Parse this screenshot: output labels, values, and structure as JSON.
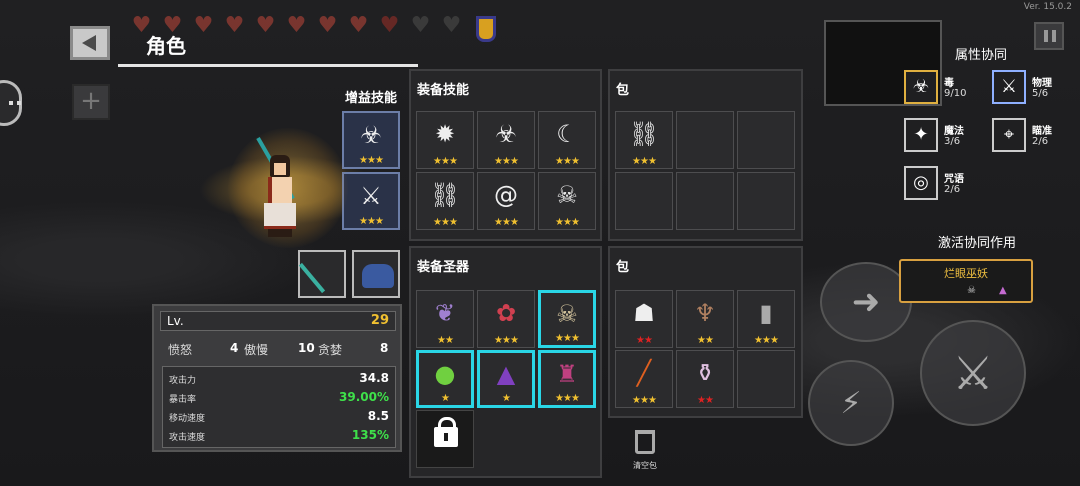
{
  "version": "Ver. 15.0.2",
  "title": "角色",
  "hearts": {
    "full": 8,
    "empty": 3,
    "half": 1
  },
  "bonus_skills": {
    "label": "增益技能",
    "slots": [
      {
        "icon": "biohazard-scythe-icon",
        "stars": "★★★"
      },
      {
        "icon": "crossed-weapons-icon",
        "stars": "★★★"
      }
    ]
  },
  "stats": {
    "lv_label": "Lv.",
    "lv_value": "29",
    "sins": [
      {
        "label": "愤怒",
        "value": "4"
      },
      {
        "label": "傲慢",
        "value": "10"
      },
      {
        "label": "贪婪",
        "value": "8"
      }
    ],
    "attributes": [
      {
        "label": "攻击力",
        "value": "34.8",
        "color": "#ffffff"
      },
      {
        "label": "暴击率",
        "value": "39.00%",
        "color": "#3ee04a"
      },
      {
        "label": "移动速度",
        "value": "8.5",
        "color": "#ffffff"
      },
      {
        "label": "攻击速度",
        "value": "135%",
        "color": "#3ee04a"
      }
    ]
  },
  "equip_skills": {
    "title": "装备技能",
    "slots": [
      {
        "icon": "spiked-wreath-icon",
        "stars": "★★★"
      },
      {
        "icon": "biohazard-icon",
        "stars": "★★★"
      },
      {
        "icon": "crescent-moon-icon",
        "stars": "★★★"
      },
      {
        "icon": "chain-link-icon",
        "stars": "★★★"
      },
      {
        "icon": "spiral-icon",
        "stars": "★★★"
      },
      {
        "icon": "skull-burst-icon",
        "stars": "★★★"
      }
    ]
  },
  "skill_bag": {
    "title": "包",
    "slots": [
      {
        "icon": "chain-link-icon",
        "stars": "★★★"
      }
    ]
  },
  "equip_relics": {
    "title": "装备圣器",
    "slots": [
      {
        "icon": "feather-icon",
        "stars": "★★"
      },
      {
        "icon": "red-flower-icon",
        "stars": "★★★"
      },
      {
        "icon": "skull-icon",
        "stars": "★★★"
      },
      {
        "icon": "green-slime-icon",
        "stars": "★"
      },
      {
        "icon": "purple-cloak-icon",
        "stars": "★"
      },
      {
        "icon": "potion-bottle-icon",
        "stars": "★★★"
      }
    ]
  },
  "relic_bag": {
    "title": "包",
    "slots": [
      {
        "icon": "white-mask-icon",
        "stars": "★★",
        "red": true
      },
      {
        "icon": "bone-figure-icon",
        "stars": "★★",
        "red": false
      },
      {
        "icon": "tombstone-icon",
        "stars": "★★★",
        "red": false
      },
      {
        "icon": "flame-sword-icon",
        "stars": "★★★",
        "red": false
      },
      {
        "icon": "flask-icon",
        "stars": "★★",
        "red": true
      }
    ]
  },
  "clear_bag": "清空包",
  "synergy": {
    "title": "属性协同",
    "items": [
      {
        "icon": "biohazard-icon",
        "name": "毒",
        "count": "9/10"
      },
      {
        "icon": "sword-icon",
        "name": "物理",
        "count": "5/6"
      },
      {
        "icon": "star-diamond-icon",
        "name": "魔法",
        "count": "3/6"
      },
      {
        "icon": "crosshair-icon",
        "name": "瞄准",
        "count": "2/6"
      },
      {
        "icon": "curse-eye-icon",
        "name": "咒语",
        "count": "2/6"
      }
    ]
  },
  "activate": {
    "label": "激活协同作用",
    "name": "烂眼巫妖"
  }
}
